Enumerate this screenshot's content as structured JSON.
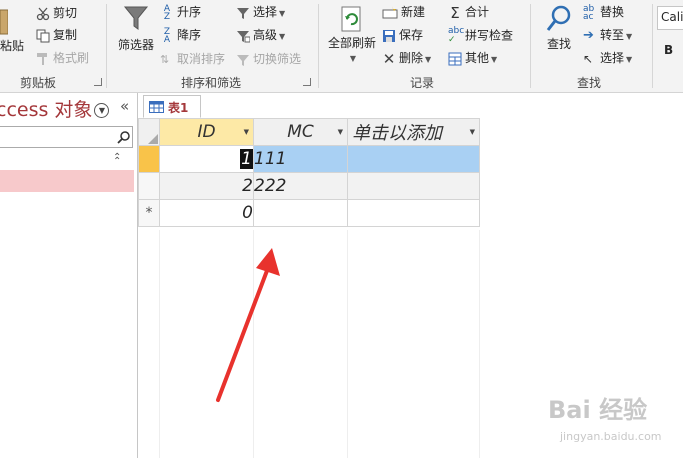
{
  "ribbon": {
    "clipboard": {
      "group_label": "剪贴板",
      "paste": "粘贴",
      "cut": "剪切",
      "copy": "复制",
      "format_painter": "格式刷"
    },
    "sort_filter": {
      "group_label": "排序和筛选",
      "filter": "筛选器",
      "ascending": "升序",
      "descending": "降序",
      "clear_sort": "取消排序",
      "selection": "选择",
      "advanced": "高级",
      "toggle_filter": "切换筛选"
    },
    "records": {
      "group_label": "记录",
      "refresh_all": "全部刷新",
      "new": "新建",
      "save": "保存",
      "delete": "删除",
      "totals": "合计",
      "spelling": "拼写检查",
      "more": "其他"
    },
    "find": {
      "group_label": "查找",
      "find": "查找",
      "replace": "替换",
      "goto": "转至",
      "select": "选择"
    },
    "font": {
      "font_name": "Cali",
      "bold": "B"
    }
  },
  "nav": {
    "title": "ccess 对象",
    "collapse": "«"
  },
  "tab": {
    "label": "表1"
  },
  "table": {
    "columns": [
      "ID",
      "MC",
      "单击以添加"
    ],
    "rows": [
      {
        "id": "1",
        "mc": "111"
      },
      {
        "id": "2",
        "mc": "222"
      }
    ],
    "new_row": {
      "marker": "*",
      "id": "0",
      "mc": ""
    }
  },
  "watermark": {
    "brand": "Bai 经验",
    "url": "jingyan.baidu.com"
  },
  "colors": {
    "access_accent": "#a4373a",
    "selected_row": "#a9d0f3",
    "active_header": "#fde9a6",
    "row_selector_current": "#f9c349",
    "arrow": "#e8322d"
  }
}
